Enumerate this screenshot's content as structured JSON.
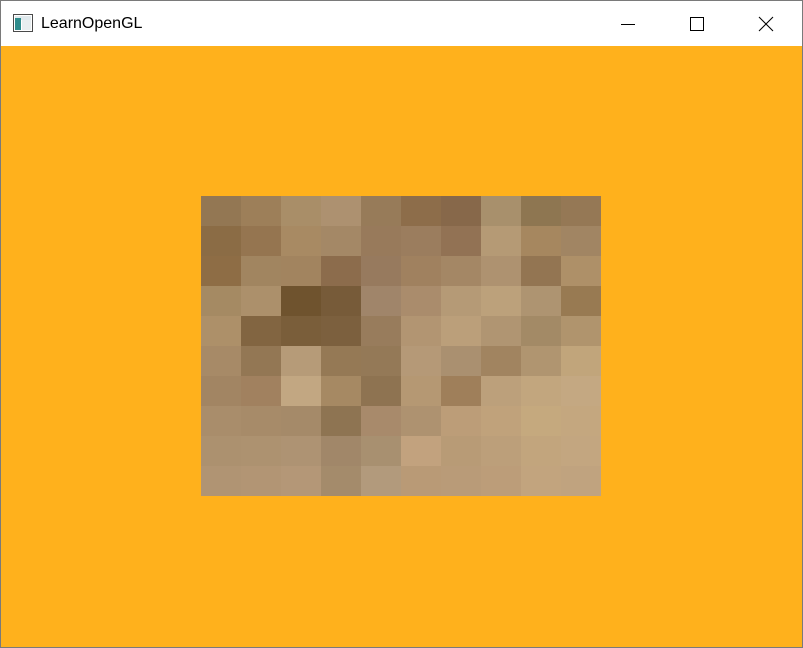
{
  "window": {
    "title": "LearnOpenGL",
    "controls": {
      "minimize_icon": "minimize-icon",
      "maximize_icon": "maximize-icon",
      "close_icon": "close-icon"
    }
  },
  "canvas": {
    "clear_color": "#FFB11C",
    "texture_grid": {
      "columns": 10,
      "rows": 10,
      "texels": [
        [
          "#937753",
          "#9d7f59",
          "#a98e68",
          "#ad9170",
          "#977b59",
          "#8d6d4a",
          "#87684a",
          "#a8906c",
          "#8e7651",
          "#957855"
        ],
        [
          "#8b6c45",
          "#957550",
          "#a88a63",
          "#a48866",
          "#987a5b",
          "#9b7d5e",
          "#927254",
          "#b59a75",
          "#a6875f",
          "#a18563"
        ],
        [
          "#8e6d45",
          "#a18560",
          "#a2845f",
          "#8c6c4c",
          "#977a5e",
          "#a0815f",
          "#a48765",
          "#ae9270",
          "#937552",
          "#ae9068"
        ],
        [
          "#a58a63",
          "#ac906b",
          "#6f532e",
          "#775b39",
          "#a0856a",
          "#aa8c6c",
          "#b59a76",
          "#bca17b",
          "#ae9471",
          "#987a52"
        ],
        [
          "#ad9069",
          "#826541",
          "#7a5e3a",
          "#7c603e",
          "#987c5c",
          "#b29572",
          "#bb9f7a",
          "#b09572",
          "#a38a66",
          "#b0946d"
        ],
        [
          "#a78a67",
          "#937754",
          "#b69b78",
          "#957955",
          "#947957",
          "#b59977",
          "#aa9070",
          "#a18460",
          "#b09570",
          "#c1a57b"
        ],
        [
          "#a28563",
          "#a1815f",
          "#c2a782",
          "#a68963",
          "#8e7351",
          "#b59873",
          "#9f7f5a",
          "#bca07b",
          "#c2a67e",
          "#c4a882"
        ],
        [
          "#a98d6b",
          "#a78b69",
          "#a58a69",
          "#8e7452",
          "#a88a6b",
          "#ae9270",
          "#bc9d78",
          "#c0a27b",
          "#c5a97e",
          "#c4a77f"
        ],
        [
          "#ac916f",
          "#ad9270",
          "#ae9373",
          "#a18769",
          "#a89070",
          "#c2a27e",
          "#b89b76",
          "#bc9f7a",
          "#c2a57d",
          "#c3a680"
        ],
        [
          "#b09473",
          "#b29574",
          "#b49777",
          "#a48b6b",
          "#b29a7c",
          "#b99a76",
          "#b99b78",
          "#bc9d79",
          "#c2a47e",
          "#c0a37f"
        ]
      ]
    }
  }
}
